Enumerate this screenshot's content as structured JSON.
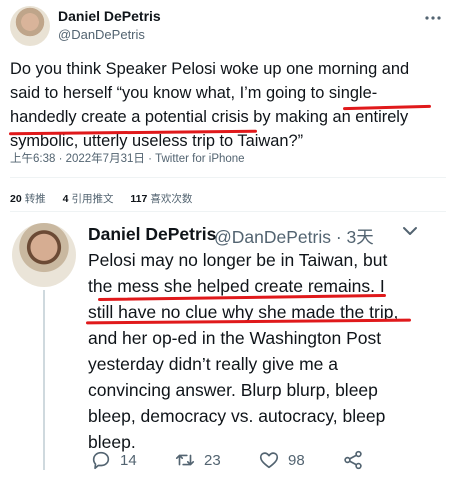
{
  "tweet": {
    "author_name": "Daniel DePetris",
    "author_handle": "@DanDePetris",
    "more_icon": "more-dots-icon",
    "lines": [
      "Do you think Speaker Pelosi woke up one morning and",
      "said to herself “you know what, I’m going to single-",
      "handedly create a potential crisis by making an entirely",
      "symbolic, utterly useless trip to Taiwan?”"
    ],
    "meta": "上午6:38 · 2022年7月31日 · Twitter for iPhone",
    "stats": [
      {
        "count": "20",
        "label": "转推"
      },
      {
        "count": "4",
        "label": "引用推文"
      },
      {
        "count": "117",
        "label": "喜欢次数"
      }
    ]
  },
  "reply": {
    "author_name": "Daniel DePetris",
    "author_handle": "@DanDePetris · 3天",
    "more_icon": "more-dots-icon",
    "lines": [
      "Pelosi may no longer be in Taiwan, but",
      "the mess she helped create remains. I",
      "still have no clue why she made the trip,",
      "and her op-ed in the Washington Post",
      "yesterday didn’t really give me a",
      "convincing answer. Blurp blurp, bleep",
      "bleep, democracy vs. autocracy, bleep",
      "bleep."
    ],
    "actions": {
      "reply_count": "14",
      "retweet_count": "23",
      "like_count": "98"
    }
  },
  "colors": {
    "text": "#0f1419",
    "secondary": "#536471",
    "annotation_red": "#e0191b"
  }
}
